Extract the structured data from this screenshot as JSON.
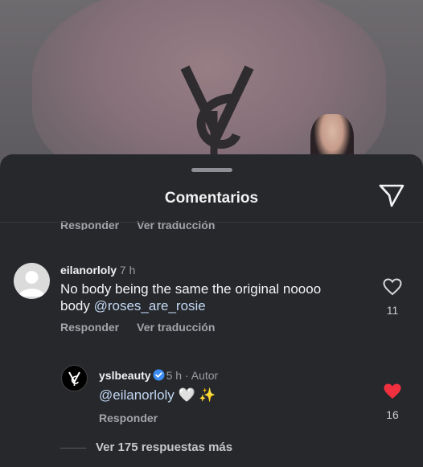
{
  "background": {
    "accent_heart": "#8a737c"
  },
  "sheet": {
    "title": "Comentarios"
  },
  "cut_actions": {
    "reply": "Responder",
    "translate": "Ver traducción"
  },
  "comment1": {
    "username": "eilanorloly",
    "time": "7 h",
    "text": "No body being the same the original noooo body",
    "mention": "@roses_are_rosie",
    "reply": "Responder",
    "translate": "Ver traducción",
    "likes": "11",
    "liked": false
  },
  "reply1": {
    "username": "yslbeauty",
    "time": "5 h",
    "author_tag": "Autor",
    "mention": "@eilanorloly",
    "emojis": "🤍 ✨",
    "reply": "Responder",
    "likes": "16",
    "liked": true,
    "like_color": "#f0303f"
  },
  "more_replies": "Ver 175 respuestas más"
}
